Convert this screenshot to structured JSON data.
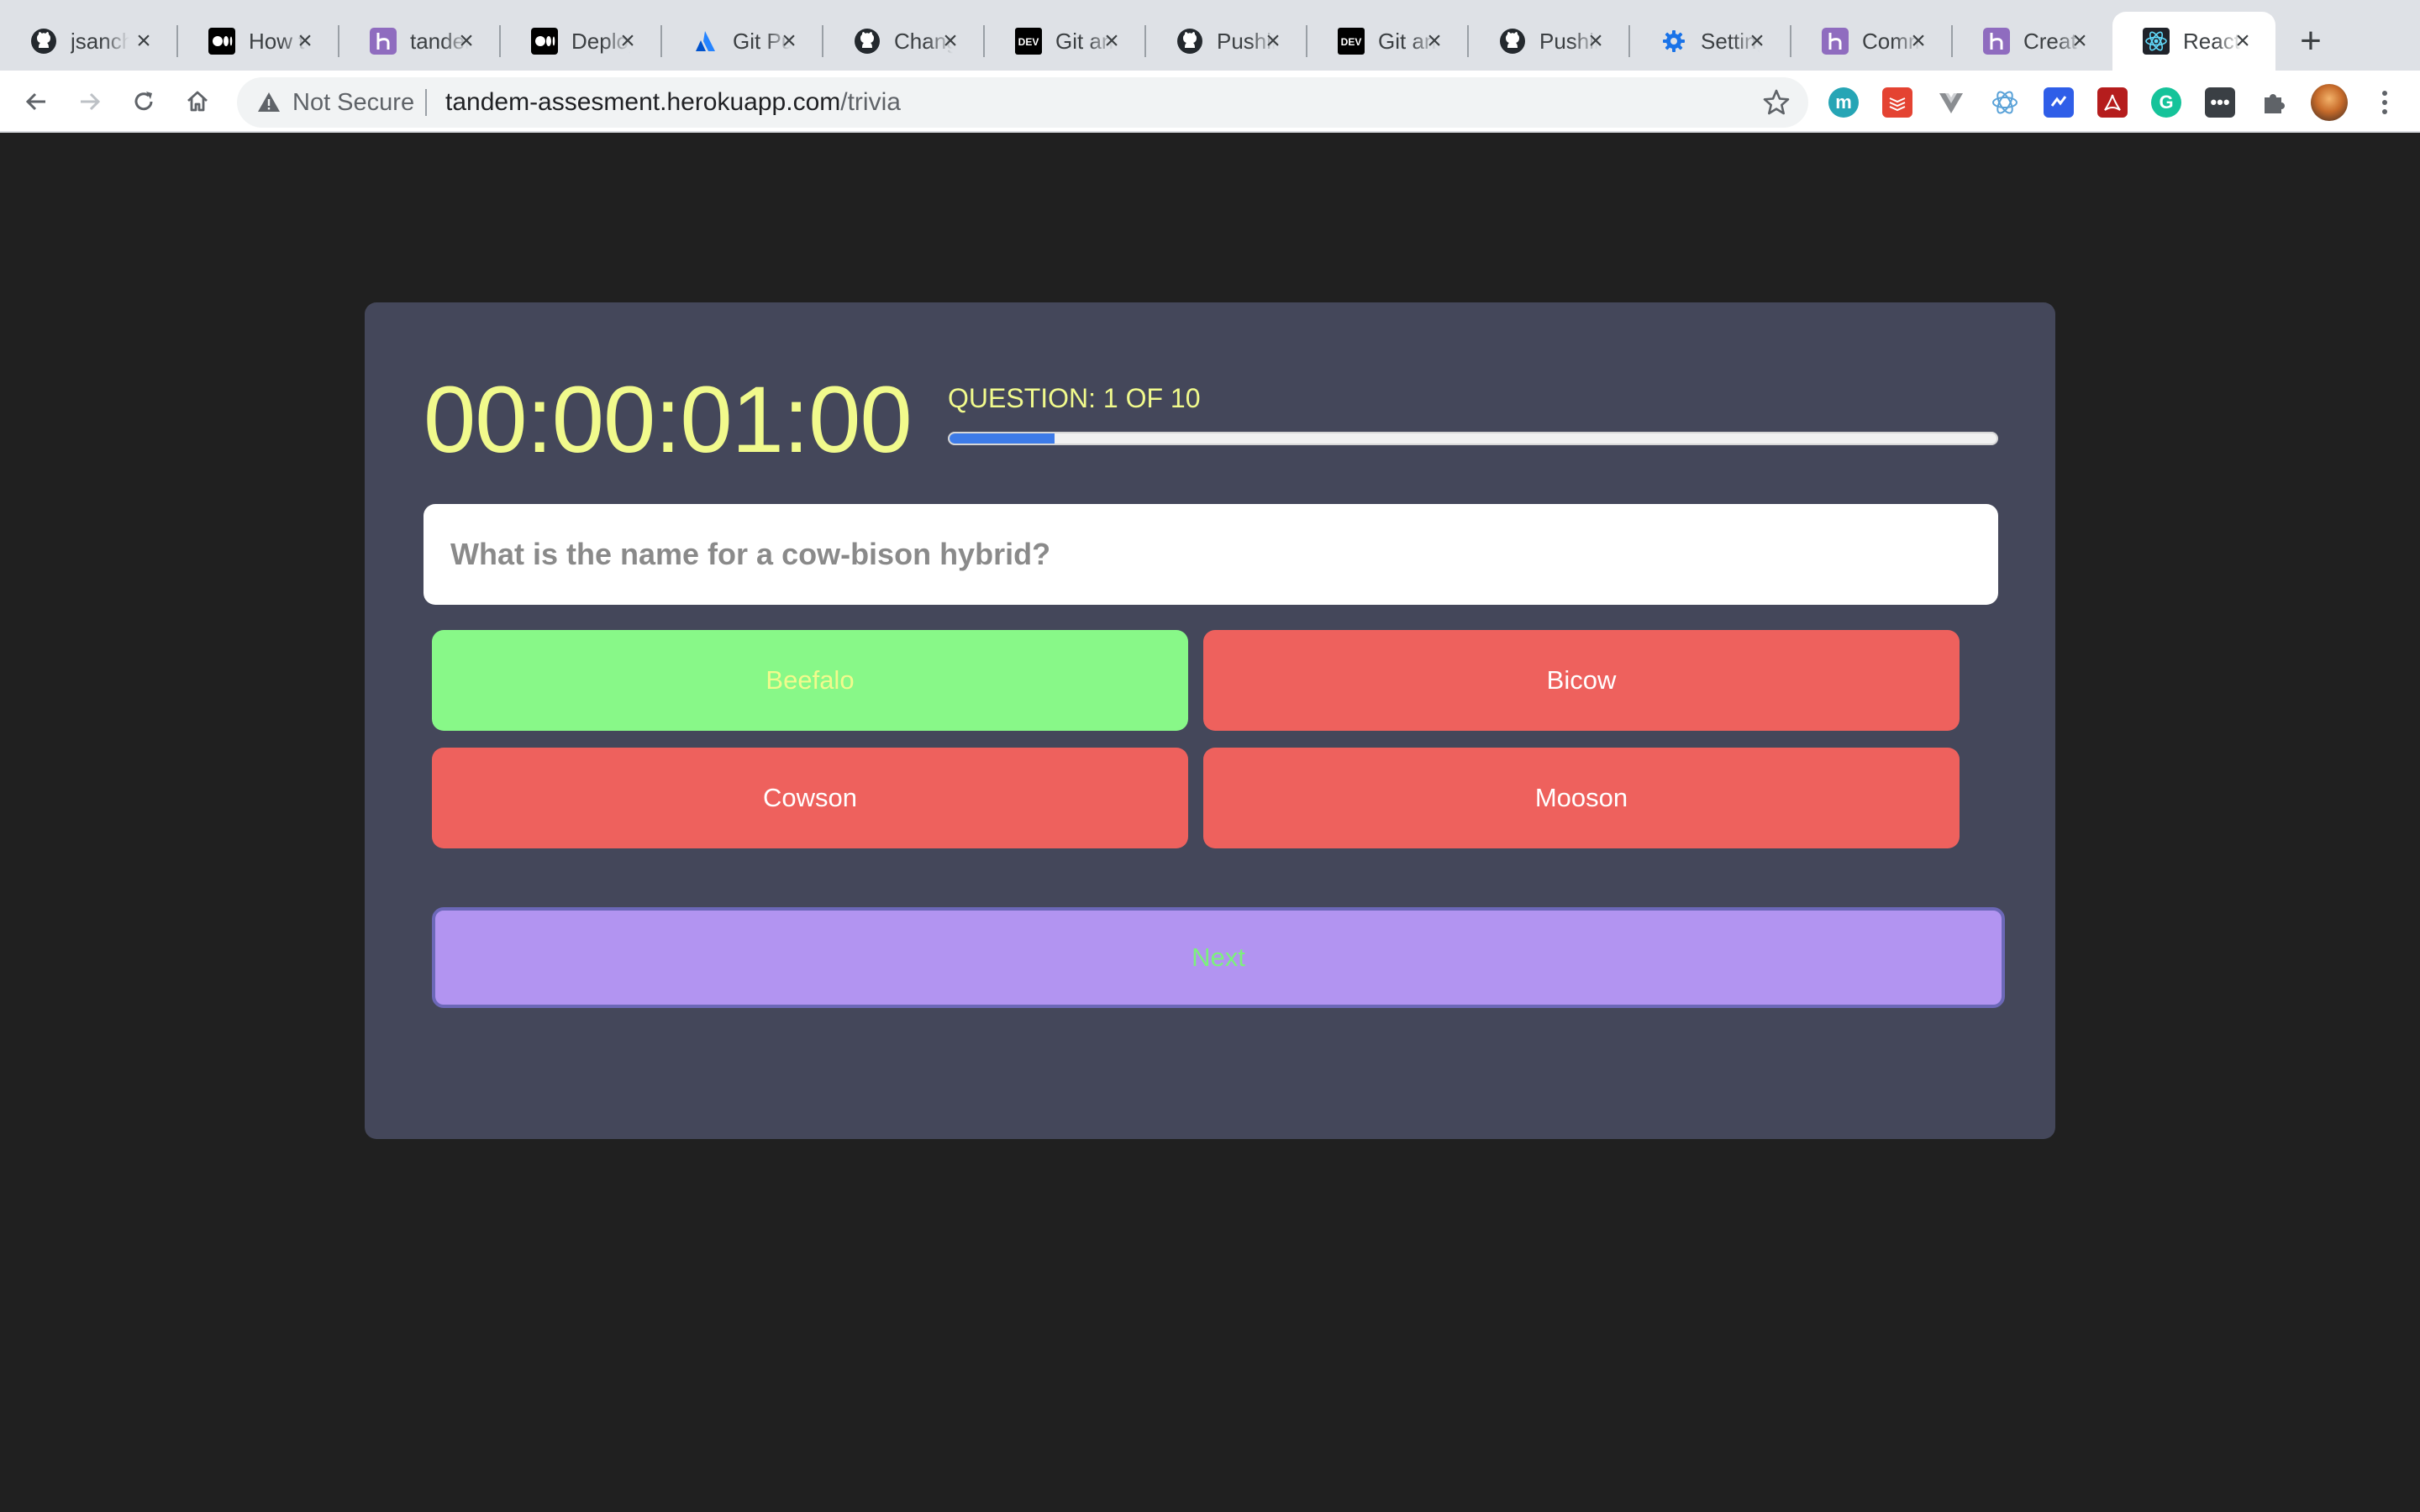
{
  "browser": {
    "tabs": [
      {
        "title": "jsanchez",
        "icon": "github-icon"
      },
      {
        "title": "How to",
        "icon": "medium-icon"
      },
      {
        "title": "tandem",
        "icon": "heroku-icon"
      },
      {
        "title": "Deploy",
        "icon": "medium-icon"
      },
      {
        "title": "Git Push",
        "icon": "atlassian-icon"
      },
      {
        "title": "Change",
        "icon": "github-icon"
      },
      {
        "title": "Git and",
        "icon": "dev-icon"
      },
      {
        "title": "Pushing",
        "icon": "github-icon"
      },
      {
        "title": "Git and",
        "icon": "dev-icon"
      },
      {
        "title": "Pushing",
        "icon": "github-icon"
      },
      {
        "title": "Settings",
        "icon": "gear-icon"
      },
      {
        "title": "Comm",
        "icon": "heroku-icon"
      },
      {
        "title": "Creat",
        "icon": "heroku-icon"
      },
      {
        "title": "React",
        "icon": "react-icon",
        "active": true
      }
    ],
    "omnibox": {
      "security_label": "Not Secure",
      "url_host": "tandem-assesment.herokuapp.com",
      "url_path": "/trivia"
    }
  },
  "quiz": {
    "timer": "00:00:01:00",
    "question_counter": "QUESTION: 1 OF 10",
    "progress_fraction": 0.1,
    "question": "What is the name for a cow-bison hybrid?",
    "answers": [
      {
        "label": "Beefalo",
        "state": "correct"
      },
      {
        "label": "Bicow",
        "state": "wrong"
      },
      {
        "label": "Cowson",
        "state": "wrong"
      },
      {
        "label": "Mooson",
        "state": "wrong"
      }
    ],
    "next_label": "Next"
  },
  "colors": {
    "page_bg": "#202020",
    "card_bg": "#44475a",
    "accent_yellow": "#f1fa8c",
    "correct_green": "#88f888",
    "wrong_red": "#ee615d",
    "next_purple": "#b294f1",
    "progress_blue": "#3d7be8"
  }
}
